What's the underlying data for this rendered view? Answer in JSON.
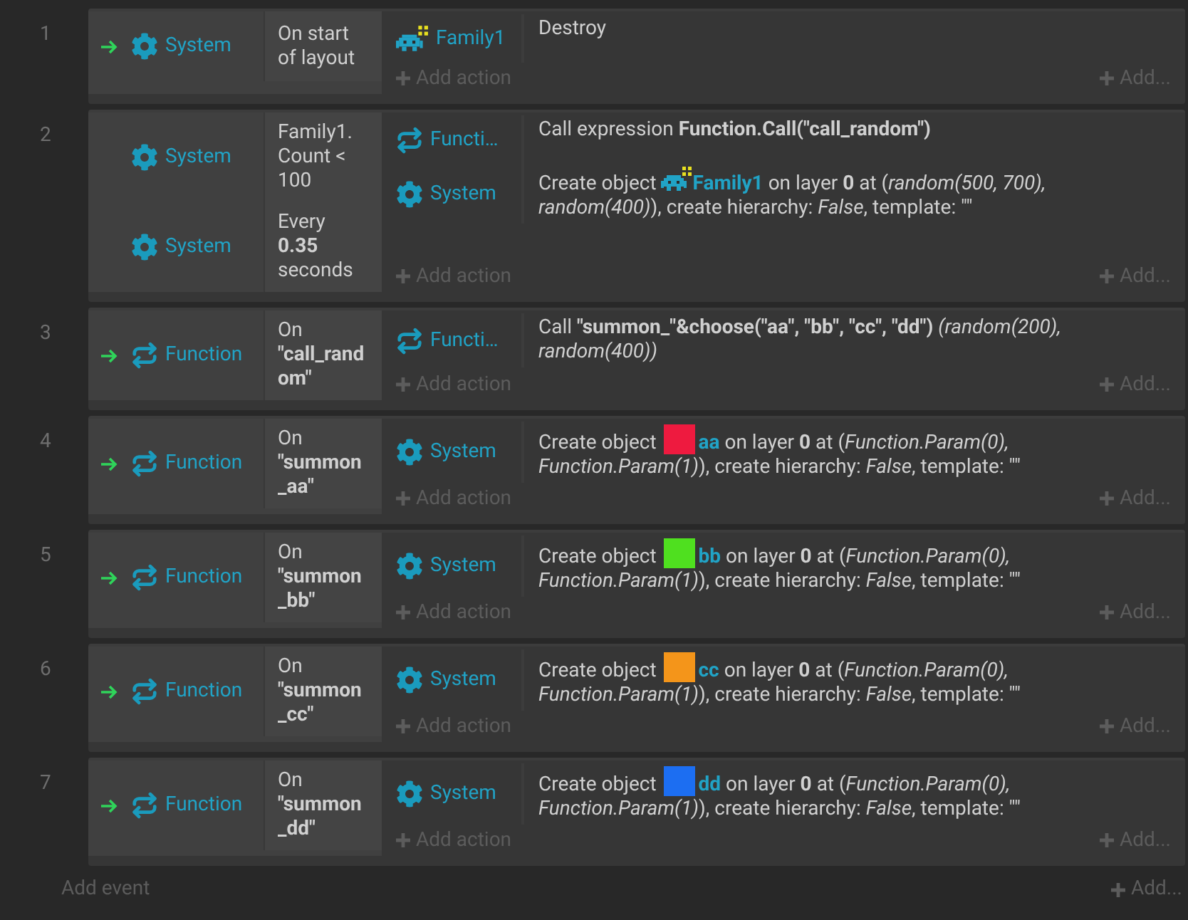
{
  "events": [
    {
      "number": "1",
      "trigger": true,
      "conditions": [
        {
          "object": "System",
          "kind": "gear",
          "text": "On start of layout"
        }
      ],
      "actions": [
        {
          "object": "Family1",
          "kind": "invader",
          "text": "Destroy"
        }
      ],
      "add_action": "Add action",
      "add_more": "Add..."
    },
    {
      "number": "2",
      "trigger": false,
      "conditions": [
        {
          "object": "System",
          "kind": "gear",
          "text": "Family1. Count < 100"
        },
        {
          "object": "System",
          "kind": "gear",
          "text": "Every **0.35** seconds"
        }
      ],
      "actions": [
        {
          "object": "Functi…",
          "kind": "loop",
          "text": "Call expression **Function.Call(\"call_random\")**"
        },
        {
          "object": "System",
          "kind": "gear",
          "text": "Create object",
          "target": {
            "name": "Family1",
            "kind": "invader"
          },
          "text_after": "on layer **0** at (*random(500, 700), random(400)*), create hierarchy: *False*, template: \"\""
        }
      ],
      "add_action": "Add action",
      "add_more": "Add..."
    },
    {
      "number": "3",
      "trigger": true,
      "conditions": [
        {
          "object": "Function",
          "kind": "loop",
          "text": "On **\"call_random\"**"
        }
      ],
      "actions": [
        {
          "object": "Functi…",
          "kind": "loop",
          "text": "Call **\"summon_\"&choose(\"aa\", \"bb\", \"cc\", \"dd\")** *(random(200), random(400))*"
        }
      ],
      "add_action": "Add action",
      "add_more": "Add..."
    },
    {
      "number": "4",
      "trigger": true,
      "conditions": [
        {
          "object": "Function",
          "kind": "loop",
          "text": "On **\"summon_aa\"**"
        }
      ],
      "actions": [
        {
          "object": "System",
          "kind": "gear",
          "text": "Create object",
          "target": {
            "name": "aa",
            "kind": "square",
            "color": "#ee1a3f"
          },
          "text_after": "on layer **0** at (*Function.Param(0), Function.Param(1)*), create hierarchy: *False*, template: \"\""
        }
      ],
      "add_action": "Add action",
      "add_more": "Add..."
    },
    {
      "number": "5",
      "trigger": true,
      "conditions": [
        {
          "object": "Function",
          "kind": "loop",
          "text": "On **\"summon_bb\"**"
        }
      ],
      "actions": [
        {
          "object": "System",
          "kind": "gear",
          "text": "Create object",
          "target": {
            "name": "bb",
            "kind": "square",
            "color": "#4fe01f"
          },
          "text_after": "on layer **0** at (*Function.Param(0), Function.Param(1)*), create hierarchy: *False*, template: \"\""
        }
      ],
      "add_action": "Add action",
      "add_more": "Add..."
    },
    {
      "number": "6",
      "trigger": true,
      "conditions": [
        {
          "object": "Function",
          "kind": "loop",
          "text": "On **\"summon_cc\"**"
        }
      ],
      "actions": [
        {
          "object": "System",
          "kind": "gear",
          "text": "Create object",
          "target": {
            "name": "cc",
            "kind": "square",
            "color": "#f4951a"
          },
          "text_after": "on layer **0** at (*Function.Param(0), Function.Param(1)*), create hierarchy: *False*, template: \"\""
        }
      ],
      "add_action": "Add action",
      "add_more": "Add..."
    },
    {
      "number": "7",
      "trigger": true,
      "conditions": [
        {
          "object": "Function",
          "kind": "loop",
          "text": "On **\"summon_dd\"**"
        }
      ],
      "actions": [
        {
          "object": "System",
          "kind": "gear",
          "text": "Create object",
          "target": {
            "name": "dd",
            "kind": "square",
            "color": "#1c6ef2"
          },
          "text_after": "on layer **0** at (*Function.Param(0), Function.Param(1)*), create hierarchy: *False*, template: \"\""
        }
      ],
      "add_action": "Add action",
      "add_more": "Add..."
    }
  ],
  "add_event": "Add event",
  "add_more": "Add..."
}
